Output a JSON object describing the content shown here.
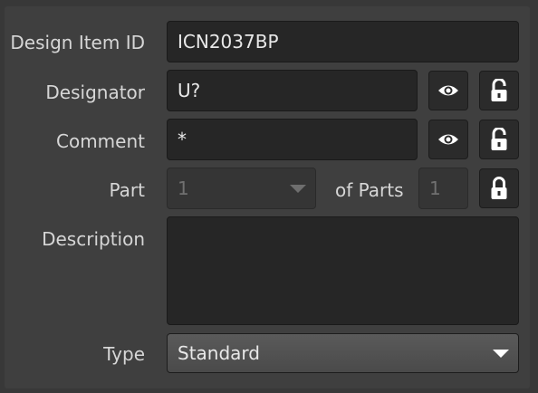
{
  "form": {
    "design_item_id": {
      "label": "Design Item ID",
      "value": "ICN2037BP"
    },
    "designator": {
      "label": "Designator",
      "value": "U?"
    },
    "comment": {
      "label": "Comment",
      "value": "*"
    },
    "part": {
      "label": "Part",
      "value": "1",
      "of_parts_label": "of Parts",
      "of_parts_value": "1"
    },
    "description": {
      "label": "Description",
      "value": ""
    },
    "type": {
      "label": "Type",
      "value": "Standard"
    }
  },
  "icons": {
    "visibility": "eye-icon",
    "unlocked": "unlocked-padlock-icon",
    "locked": "locked-padlock-icon",
    "dropdown": "chevron-down-icon"
  },
  "colors": {
    "background": "#383838",
    "panel": "#3f3f3f",
    "field": "#262626",
    "text": "#d6d6d6"
  }
}
